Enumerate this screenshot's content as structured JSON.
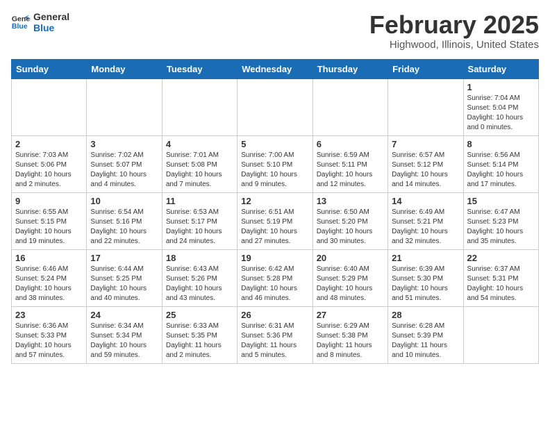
{
  "logo": {
    "line1": "General",
    "line2": "Blue"
  },
  "title": "February 2025",
  "subtitle": "Highwood, Illinois, United States",
  "weekdays": [
    "Sunday",
    "Monday",
    "Tuesday",
    "Wednesday",
    "Thursday",
    "Friday",
    "Saturday"
  ],
  "weeks": [
    [
      {
        "day": "",
        "info": ""
      },
      {
        "day": "",
        "info": ""
      },
      {
        "day": "",
        "info": ""
      },
      {
        "day": "",
        "info": ""
      },
      {
        "day": "",
        "info": ""
      },
      {
        "day": "",
        "info": ""
      },
      {
        "day": "1",
        "info": "Sunrise: 7:04 AM\nSunset: 5:04 PM\nDaylight: 10 hours\nand 0 minutes."
      }
    ],
    [
      {
        "day": "2",
        "info": "Sunrise: 7:03 AM\nSunset: 5:06 PM\nDaylight: 10 hours\nand 2 minutes."
      },
      {
        "day": "3",
        "info": "Sunrise: 7:02 AM\nSunset: 5:07 PM\nDaylight: 10 hours\nand 4 minutes."
      },
      {
        "day": "4",
        "info": "Sunrise: 7:01 AM\nSunset: 5:08 PM\nDaylight: 10 hours\nand 7 minutes."
      },
      {
        "day": "5",
        "info": "Sunrise: 7:00 AM\nSunset: 5:10 PM\nDaylight: 10 hours\nand 9 minutes."
      },
      {
        "day": "6",
        "info": "Sunrise: 6:59 AM\nSunset: 5:11 PM\nDaylight: 10 hours\nand 12 minutes."
      },
      {
        "day": "7",
        "info": "Sunrise: 6:57 AM\nSunset: 5:12 PM\nDaylight: 10 hours\nand 14 minutes."
      },
      {
        "day": "8",
        "info": "Sunrise: 6:56 AM\nSunset: 5:14 PM\nDaylight: 10 hours\nand 17 minutes."
      }
    ],
    [
      {
        "day": "9",
        "info": "Sunrise: 6:55 AM\nSunset: 5:15 PM\nDaylight: 10 hours\nand 19 minutes."
      },
      {
        "day": "10",
        "info": "Sunrise: 6:54 AM\nSunset: 5:16 PM\nDaylight: 10 hours\nand 22 minutes."
      },
      {
        "day": "11",
        "info": "Sunrise: 6:53 AM\nSunset: 5:17 PM\nDaylight: 10 hours\nand 24 minutes."
      },
      {
        "day": "12",
        "info": "Sunrise: 6:51 AM\nSunset: 5:19 PM\nDaylight: 10 hours\nand 27 minutes."
      },
      {
        "day": "13",
        "info": "Sunrise: 6:50 AM\nSunset: 5:20 PM\nDaylight: 10 hours\nand 30 minutes."
      },
      {
        "day": "14",
        "info": "Sunrise: 6:49 AM\nSunset: 5:21 PM\nDaylight: 10 hours\nand 32 minutes."
      },
      {
        "day": "15",
        "info": "Sunrise: 6:47 AM\nSunset: 5:23 PM\nDaylight: 10 hours\nand 35 minutes."
      }
    ],
    [
      {
        "day": "16",
        "info": "Sunrise: 6:46 AM\nSunset: 5:24 PM\nDaylight: 10 hours\nand 38 minutes."
      },
      {
        "day": "17",
        "info": "Sunrise: 6:44 AM\nSunset: 5:25 PM\nDaylight: 10 hours\nand 40 minutes."
      },
      {
        "day": "18",
        "info": "Sunrise: 6:43 AM\nSunset: 5:26 PM\nDaylight: 10 hours\nand 43 minutes."
      },
      {
        "day": "19",
        "info": "Sunrise: 6:42 AM\nSunset: 5:28 PM\nDaylight: 10 hours\nand 46 minutes."
      },
      {
        "day": "20",
        "info": "Sunrise: 6:40 AM\nSunset: 5:29 PM\nDaylight: 10 hours\nand 48 minutes."
      },
      {
        "day": "21",
        "info": "Sunrise: 6:39 AM\nSunset: 5:30 PM\nDaylight: 10 hours\nand 51 minutes."
      },
      {
        "day": "22",
        "info": "Sunrise: 6:37 AM\nSunset: 5:31 PM\nDaylight: 10 hours\nand 54 minutes."
      }
    ],
    [
      {
        "day": "23",
        "info": "Sunrise: 6:36 AM\nSunset: 5:33 PM\nDaylight: 10 hours\nand 57 minutes."
      },
      {
        "day": "24",
        "info": "Sunrise: 6:34 AM\nSunset: 5:34 PM\nDaylight: 10 hours\nand 59 minutes."
      },
      {
        "day": "25",
        "info": "Sunrise: 6:33 AM\nSunset: 5:35 PM\nDaylight: 11 hours\nand 2 minutes."
      },
      {
        "day": "26",
        "info": "Sunrise: 6:31 AM\nSunset: 5:36 PM\nDaylight: 11 hours\nand 5 minutes."
      },
      {
        "day": "27",
        "info": "Sunrise: 6:29 AM\nSunset: 5:38 PM\nDaylight: 11 hours\nand 8 minutes."
      },
      {
        "day": "28",
        "info": "Sunrise: 6:28 AM\nSunset: 5:39 PM\nDaylight: 11 hours\nand 10 minutes."
      },
      {
        "day": "",
        "info": ""
      }
    ]
  ]
}
